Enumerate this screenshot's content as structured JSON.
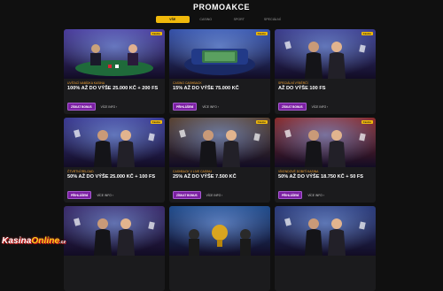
{
  "page": {
    "title": "PROMOAKCE"
  },
  "tabs": [
    {
      "label": "Vše",
      "active": true
    },
    {
      "label": "Casino",
      "active": false
    },
    {
      "label": "Sport",
      "active": false
    },
    {
      "label": "Speciální",
      "active": false
    }
  ],
  "cards": [
    {
      "badge": "Casino",
      "category": "Uvítací nabídka kasina",
      "title": "100% až do výše 25.000 Kč + 200 FS",
      "button": "Získat bonus",
      "more": "Více info",
      "theme": "poker-table",
      "accent": "#4a3a9a"
    },
    {
      "badge": "Casino",
      "category": "Casino cashback",
      "title": "15% až do výše 75.000 Kč",
      "button": "Přihlášení",
      "more": "Více info",
      "theme": "money-sofa",
      "accent": "#3450a8"
    },
    {
      "badge": "Casino",
      "category": "Speciální výběrčí",
      "title": "až do výše 100 FS",
      "button": "Získat bonus",
      "more": "Více info",
      "theme": "couple-night",
      "accent": "#3a3a8a"
    },
    {
      "badge": "Casino",
      "category": "Čtvrtní reload",
      "title": "50% až do výše 25.000 Kč + 100 FS",
      "button": "Přihlášení",
      "more": "Více info",
      "theme": "man-cards",
      "accent": "#3a3890"
    },
    {
      "badge": "Casino",
      "category": "Cashback v live casinu",
      "title": "25% až do výše 7.500 Kč",
      "button": "Získat bonus",
      "more": "Více info",
      "theme": "woman-casino",
      "accent": "#5a4230"
    },
    {
      "badge": "Casino",
      "category": "Víkendové dobití kasina",
      "title": "50% až do výše 18.750 Kč + 50 FS",
      "button": "Přihlášení",
      "more": "Více info",
      "theme": "man-slots",
      "accent": "#8a2a2a"
    },
    {
      "badge": "",
      "category": "",
      "title": "",
      "button": "",
      "more": "",
      "theme": "group",
      "accent": "#3a2a6a"
    },
    {
      "badge": "",
      "category": "",
      "title": "",
      "button": "",
      "more": "",
      "theme": "trophy",
      "accent": "#1e4a8a"
    },
    {
      "badge": "",
      "category": "",
      "title": "",
      "button": "",
      "more": "",
      "theme": "dj",
      "accent": "#2a3a7a"
    }
  ],
  "logo": {
    "part1": "Kasina",
    "part2": "Online",
    "suffix": ".cz"
  }
}
